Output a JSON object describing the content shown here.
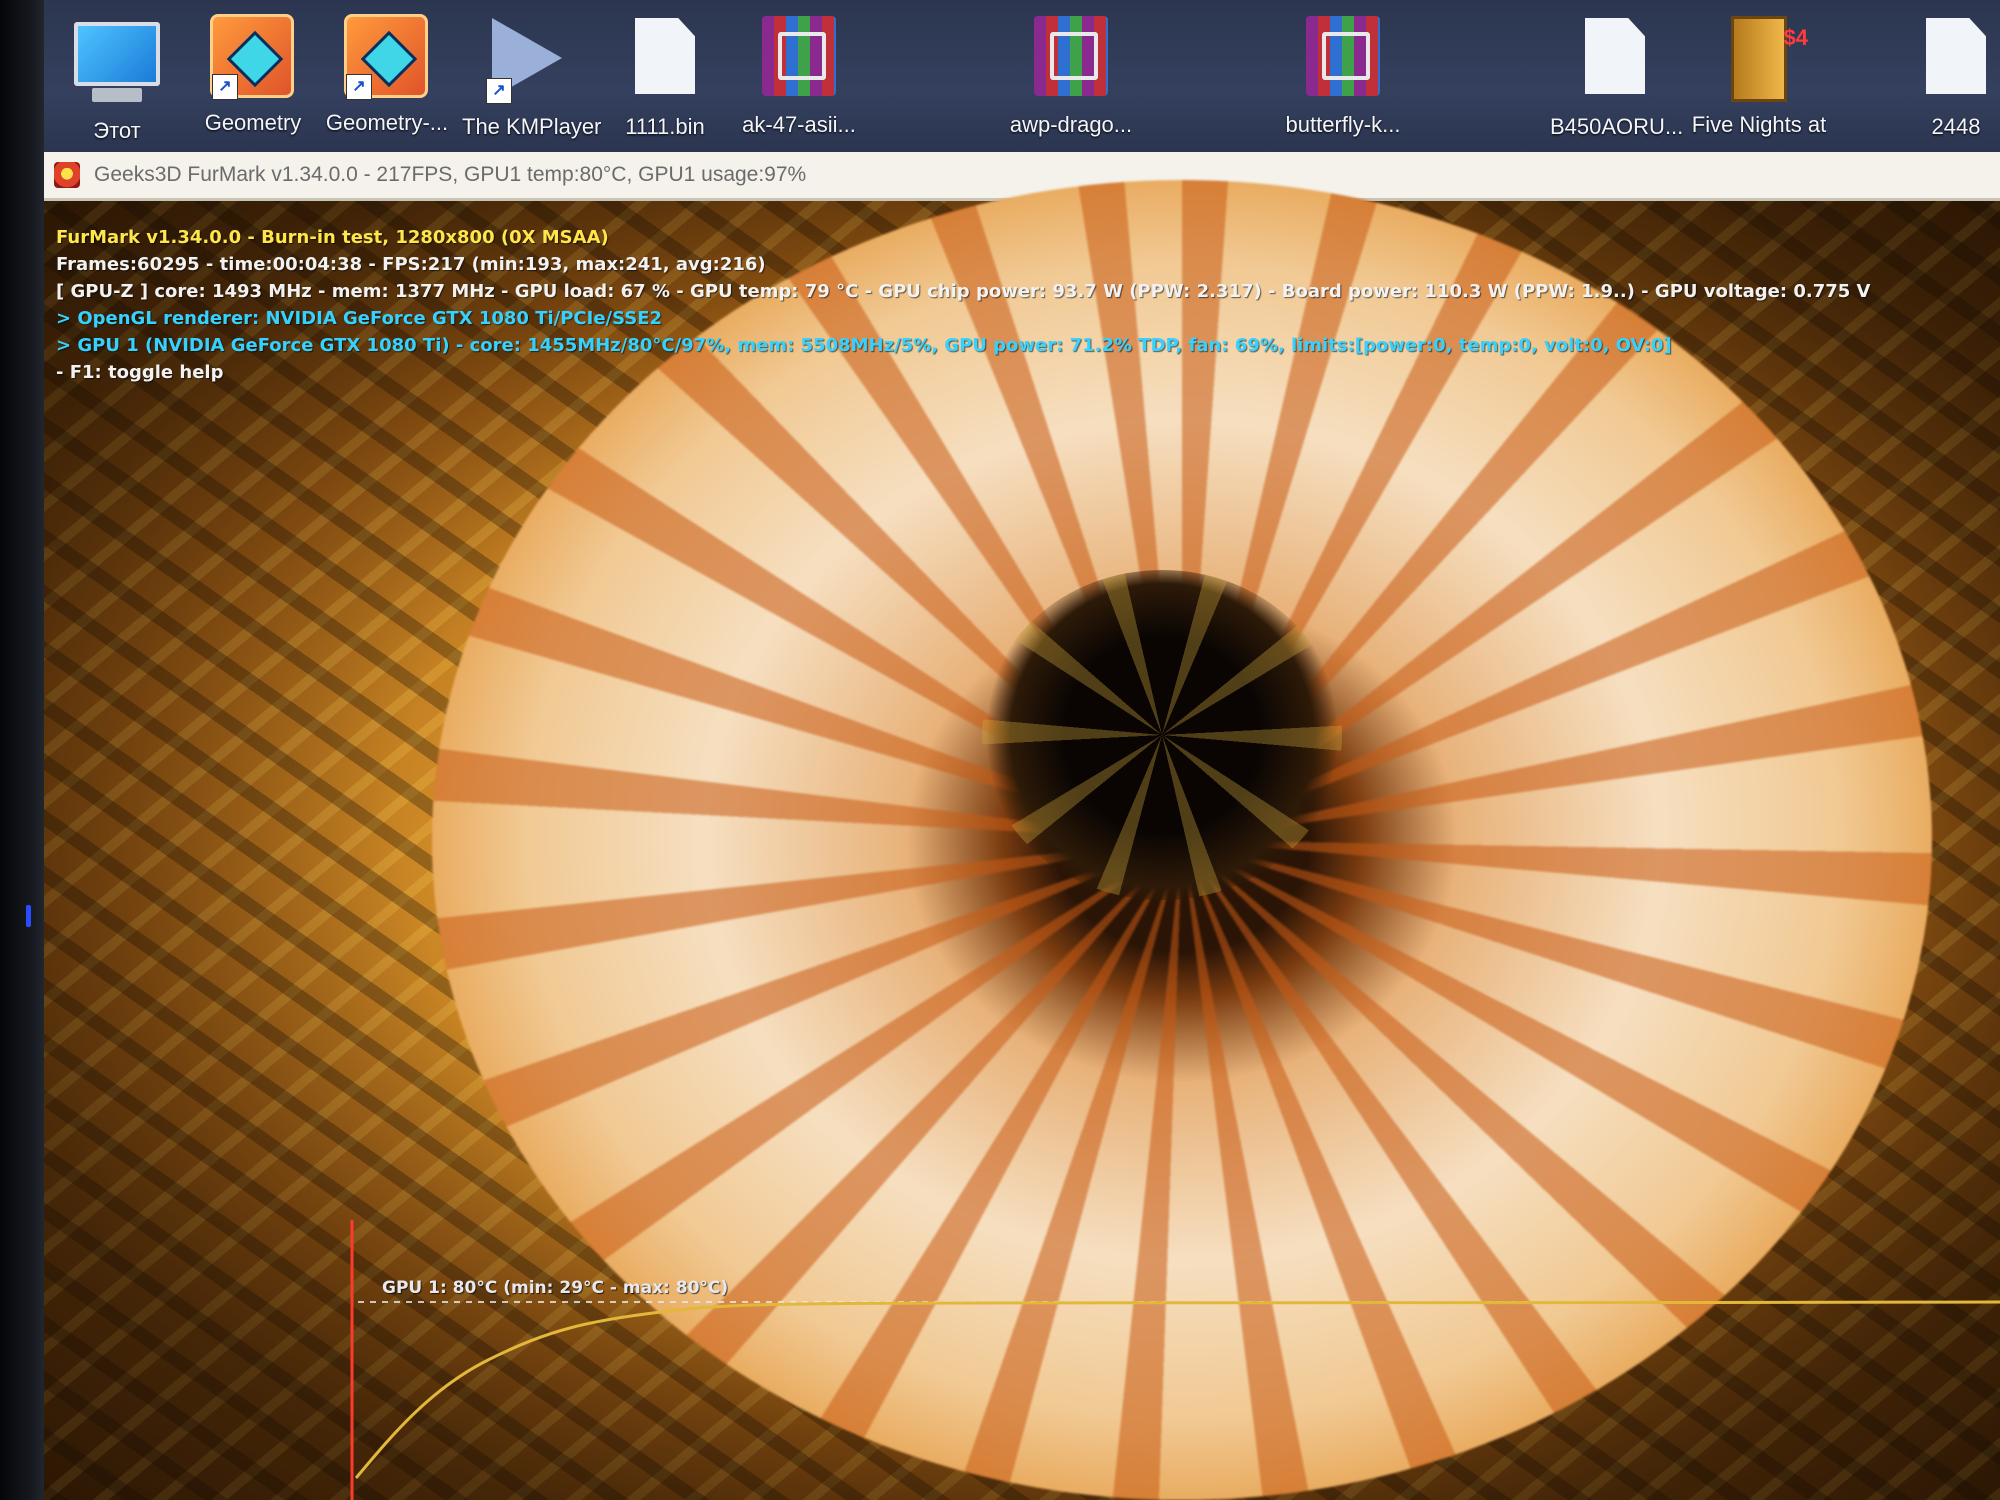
{
  "desktop": {
    "icons": [
      {
        "label": "Этот",
        "icon": "computer-icon"
      },
      {
        "label": "Geometry",
        "icon": "geometry-dash-icon"
      },
      {
        "label": "Geometry-...",
        "icon": "geometry-dash-icon"
      },
      {
        "label": "The KMPlayer",
        "icon": "kmplayer-icon"
      },
      {
        "label": "1111.bin",
        "icon": "file-icon"
      },
      {
        "label": "ak-47-asii...",
        "icon": "winrar-archive-icon"
      },
      {
        "label": "awp-drago...",
        "icon": "winrar-archive-icon"
      },
      {
        "label": "butterfly-k...",
        "icon": "winrar-archive-icon"
      },
      {
        "label": "B450AORU...",
        "icon": "file-icon"
      },
      {
        "label": "Five Nights at",
        "icon": "fnaf-door-icon"
      },
      {
        "label": "2448",
        "icon": "file-icon"
      }
    ]
  },
  "window": {
    "title": "Geeks3D FurMark v1.34.0.0 - 217FPS, GPU1 temp:80°C, GPU1 usage:97%",
    "icon": "furmark-icon"
  },
  "osd": {
    "line1": "FurMark v1.34.0.0 - Burn-in test, 1280x800 (0X MSAA)",
    "line2": "Frames:60295 - time:00:04:38 - FPS:217 (min:193, max:241, avg:216)",
    "line3": "[ GPU-Z ] core: 1493 MHz - mem: 1377 MHz - GPU load: 67 % - GPU temp: 79 °C - GPU chip power: 93.7 W (PPW: 2.317) - Board power: 110.3 W (PPW: 1.9..) - GPU voltage: 0.775 V",
    "line4": "> OpenGL renderer: NVIDIA GeForce GTX 1080 Ti/PCIe/SSE2",
    "line5": "> GPU 1 (NVIDIA GeForce GTX 1080 Ti) - core: 1455MHz/80°C/97%, mem: 5508MHz/5%, GPU power: 71.2% TDP, fan: 69%, limits:[power:0, temp:0, volt:0, OV:0]",
    "line6": "- F1: toggle help"
  },
  "temp_graph": {
    "label": "GPU 1: 80°C (min: 29°C - max: 80°C)",
    "current_c": 80,
    "min_c": 29,
    "max_c": 80,
    "line_color": "#e2b83a",
    "axis_color": "#ff3a2a"
  }
}
